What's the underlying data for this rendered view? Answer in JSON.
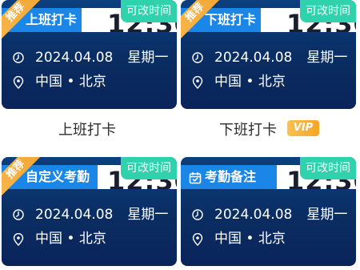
{
  "change_time_label": "可改时间",
  "recommend_label": "推荐",
  "time_text": "12:30",
  "date_text": "2024.04.08",
  "weekday_text": "星期一",
  "location_text": "中国 • 北京",
  "cards": [
    {
      "tag": "上班打卡",
      "badge": "推荐"
    },
    {
      "tag": "下班打卡",
      "badge": "推荐"
    },
    {
      "tag": "自定义考勤",
      "badge": "推荐"
    },
    {
      "tag": "考勤备注",
      "badge": ""
    }
  ],
  "labels": {
    "clock_in": "上班打卡",
    "clock_out": "下班打卡",
    "vip": "VIP"
  },
  "colors": {
    "card_bg": "#0a2d62",
    "tag_blue": "#1a86e8",
    "change_green": "#2fd2ad",
    "ribbon_orange": "#f4a635"
  }
}
